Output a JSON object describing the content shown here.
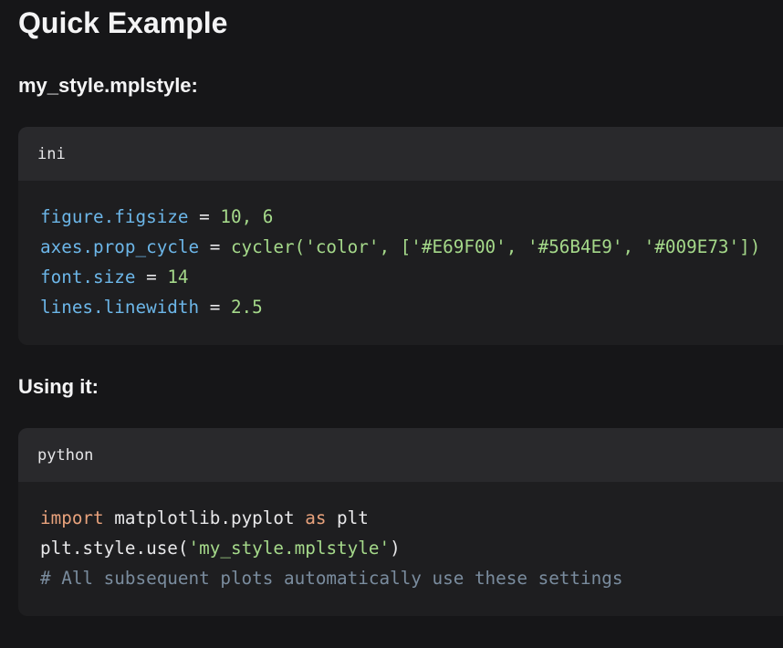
{
  "headings": {
    "title": "Quick Example",
    "style_file": "my_style.mplstyle:",
    "using": "Using it:"
  },
  "ini_block": {
    "lang": "ini",
    "lines": [
      {
        "key": "figure.figsize",
        "op": " = ",
        "value": "10, 6"
      },
      {
        "key": "axes.prop_cycle",
        "op": " = ",
        "value": "cycler('color', ['#E69F00', '#56B4E9', '#009E73'])"
      },
      {
        "key": "font.size",
        "op": " = ",
        "value": "14"
      },
      {
        "key": "lines.linewidth",
        "op": " = ",
        "value": "2.5"
      }
    ]
  },
  "python_block": {
    "lang": "python",
    "line1": {
      "kw_import": "import",
      "module": " matplotlib.pyplot ",
      "kw_as": "as",
      "alias": " plt"
    },
    "line2": {
      "call": "plt.style.use(",
      "arg": "'my_style.mplstyle'",
      "close": ")"
    },
    "line3": {
      "comment": "# All subsequent plots automatically use these settings"
    }
  },
  "colors": {
    "background": "#161618",
    "code_bg": "#1e1e20",
    "code_header_bg": "#29292c",
    "key": "#6cb6e8",
    "string": "#a5d98a",
    "keyword": "#e8a27c",
    "comment": "#7a8c9e"
  }
}
